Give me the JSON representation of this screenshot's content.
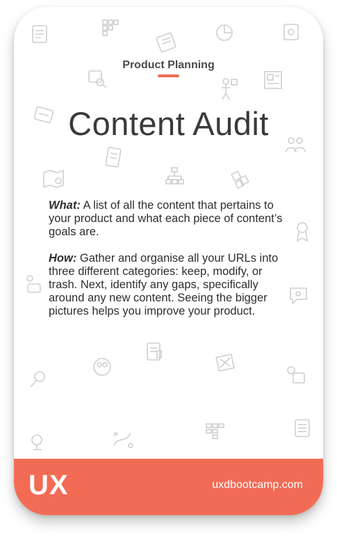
{
  "card": {
    "category": "Product Planning",
    "title": "Content Audit",
    "what_label": "What:",
    "what_text": " A list of all the content that pertains to your product and what each piece of content’s goals are.",
    "how_label": "How:",
    "how_text": " Gather and organise all your URLs into three different categories: keep, modify, or trash. Next, identify any gaps, specifically around any new content. Seeing the bigger pictures helps you improve your product."
  },
  "footer": {
    "brand": "UX",
    "website": "uxdbootcamp.com"
  },
  "colors": {
    "accent": "#f26b55",
    "text": "#3a3a3a",
    "background": "#ffffff"
  },
  "background_icons": [
    "document-icon",
    "grid-icon",
    "list-icon",
    "chart-icon",
    "book-icon",
    "search-icon",
    "person-icon",
    "map-icon",
    "people-icon",
    "sitemap-icon",
    "puzzle-icon",
    "award-icon",
    "speech-icon",
    "location-icon",
    "strategy-icon",
    "layout-icon"
  ]
}
